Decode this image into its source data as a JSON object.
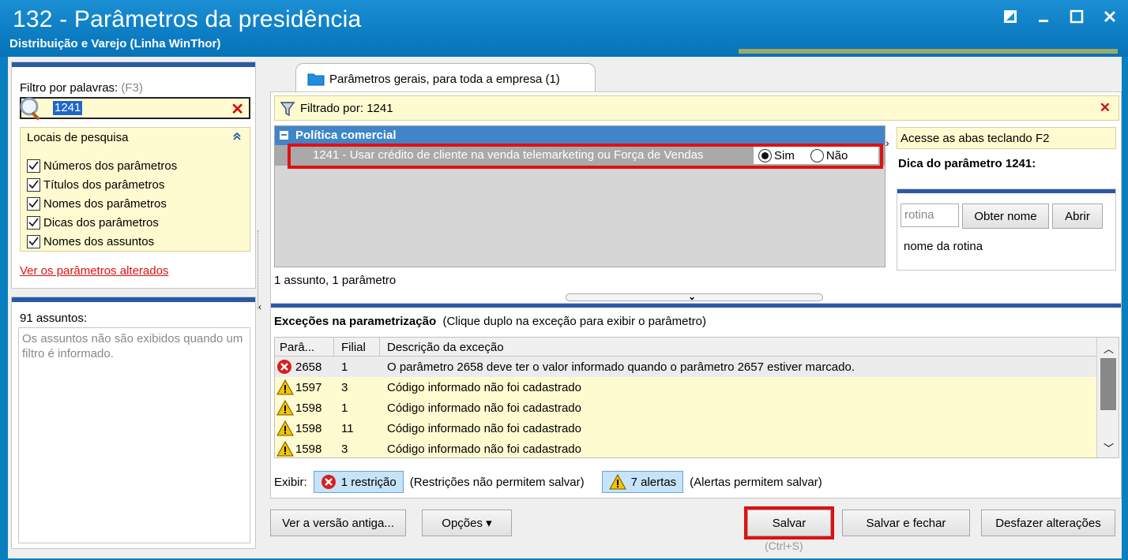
{
  "window": {
    "title": "132 - Parâmetros da presidência",
    "subtitle": "Distribuição e Varejo (Linha WinThor)"
  },
  "filter": {
    "label": "Filtro por palavras:",
    "hotkey": "(F3)",
    "value": "1241",
    "locais_title": "Locais de pesquisa",
    "locais": [
      {
        "label": "Números dos parâmetros",
        "checked": true
      },
      {
        "label": "Títulos dos parâmetros",
        "checked": true
      },
      {
        "label": "Nomes dos parâmetros",
        "checked": true
      },
      {
        "label": "Dicas dos parâmetros",
        "checked": true
      },
      {
        "label": "Nomes dos assuntos",
        "checked": true
      }
    ],
    "altered_link": "Ver os parâmetros alterados"
  },
  "assuntos": {
    "count": "91 assuntos:",
    "note": "Os assuntos não são exibidos quando um filtro é informado."
  },
  "tab": {
    "label": "Parâmetros gerais, para toda a empresa  (1)"
  },
  "filtered": {
    "text": "Filtrado por: 1241"
  },
  "param_group": {
    "title": "Política comercial",
    "row": "1241 - Usar crédito de cliente na venda telemarketing ou Força de Vendas",
    "opt_sim": "Sim",
    "opt_nao": "Não",
    "selected": "Sim"
  },
  "summary": "1 assunto, 1 parâmetro",
  "tip": {
    "bar": "Acesse as abas teclando F2",
    "dica_title": "Dica do parâmetro 1241:",
    "rotina_placeholder": "rotina",
    "obter_nome": "Obter nome",
    "abrir": "Abrir",
    "nome_rotina": "nome da rotina"
  },
  "exceptions": {
    "title": "Exceções na parametrização",
    "subtitle": "(Clique duplo na exceção para exibir o parâmetro)",
    "columns": [
      "Parâ...",
      "Filial",
      "Descrição da exceção"
    ],
    "rows": [
      {
        "type": "error",
        "param": "2658",
        "filial": "1",
        "desc": "O parâmetro 2658 deve ter o valor informado quando o parâmetro 2657 estiver marcado."
      },
      {
        "type": "warning",
        "param": "1597",
        "filial": "3",
        "desc": "Código informado não foi cadastrado"
      },
      {
        "type": "warning",
        "param": "1598",
        "filial": "1",
        "desc": "Código informado não foi cadastrado"
      },
      {
        "type": "warning",
        "param": "1598",
        "filial": "11",
        "desc": "Código informado não foi cadastrado"
      },
      {
        "type": "warning",
        "param": "1598",
        "filial": "3",
        "desc": "Código informado não foi cadastrado"
      }
    ],
    "exibir_label": "Exibir:",
    "restricao_btn": "1 restrição",
    "restricao_note": "(Restrições não permitem salvar)",
    "alertas_btn": "7 alertas",
    "alertas_note": "(Alertas permitem salvar)"
  },
  "buttons": {
    "versao_antiga": "Ver a versão antiga...",
    "opcoes": "Opções ▾",
    "salvar": "Salvar",
    "salvar_shortcut": "(Ctrl+S)",
    "salvar_fechar": "Salvar e fechar",
    "desfazer": "Desfazer alterações"
  },
  "colors": {
    "title_bg": "#0d7dc4",
    "accent_bar": "#2b58a5",
    "group_header": "#3f85c8",
    "highlight_yellow": "#fffbd0",
    "highlight_red": "#e01010"
  }
}
